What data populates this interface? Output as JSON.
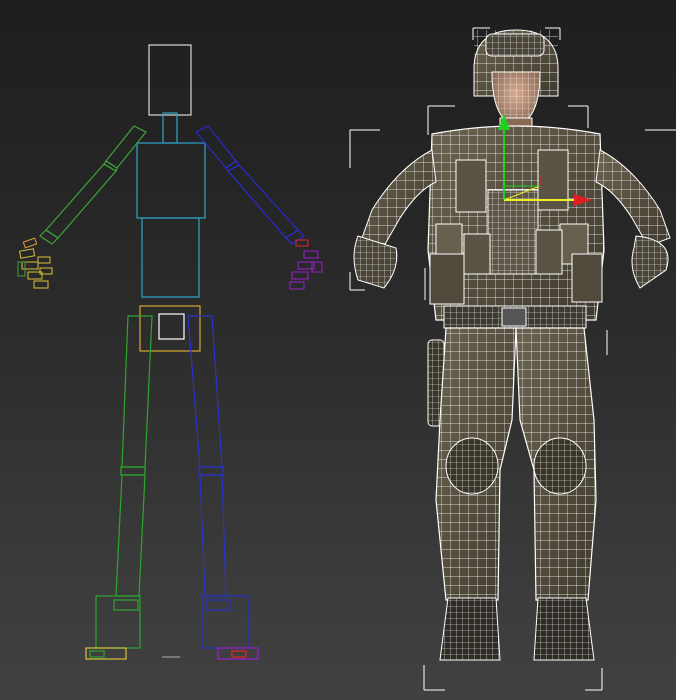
{
  "viewport": {
    "background_top": "#1e1e1e",
    "background_bottom": "#414141"
  },
  "biped_rig": {
    "colors": {
      "spine": "#2fa3c8",
      "head": "#d8d8d8",
      "pelvis": "#d8a630",
      "left_arm": "#3fa13a",
      "right_arm": "#2a2ad0",
      "left_leg": "#2ea52e",
      "right_leg": "#2a33c8",
      "left_hand": "#d6c23a",
      "right_hand": "#9a1fd0",
      "hand_tip": "#e02828"
    }
  },
  "soldier_mesh": {
    "wire_color": "#ffffff",
    "diffuse_dark": "#3f3a2e",
    "diffuse_light": "#6b6350",
    "gizmo": {
      "y_axis": "#1fd01f",
      "x_axis": "#e02020",
      "selected_axis": "#f0f020"
    }
  }
}
